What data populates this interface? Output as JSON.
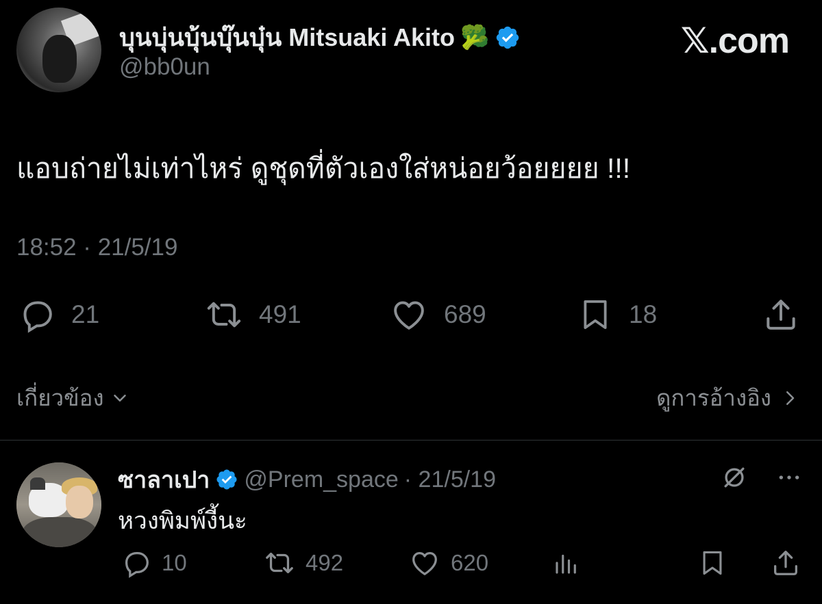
{
  "brand": {
    "text": "𝕏.com"
  },
  "main_tweet": {
    "author_name": "บุนบุ่นบุ้นบุ๊นบุ๋น Mitsuaki Akito",
    "name_emoji": "🥦",
    "handle": "@bb0un",
    "verified": true,
    "text": "แอบถ่ายไม่เท่าไหร่ ดูชุดที่ตัวเองใส่หน่อยว้อยยยย !!!",
    "timestamp": "18:52 · 21/5/19",
    "stats": {
      "replies": "21",
      "retweets": "491",
      "likes": "689",
      "bookmarks": "18"
    }
  },
  "related": {
    "label": "เกี่ยวข้อง"
  },
  "quotes": {
    "label": "ดูการอ้างอิง"
  },
  "reply": {
    "author_name": "ซาลาเปา",
    "verified": true,
    "handle": "@Prem_space",
    "date": "· 21/5/19",
    "text": "หวงพิมพ์งี้นะ",
    "stats": {
      "replies": "10",
      "retweets": "492",
      "likes": "620"
    }
  },
  "colors": {
    "background": "#000000",
    "text_primary": "#e7e9ea",
    "text_secondary": "#71767b",
    "verified_blue": "#1d9bf0",
    "divider": "#2f3336"
  },
  "icons": [
    "reply-icon",
    "retweet-icon",
    "like-icon",
    "bookmark-icon",
    "share-icon",
    "chevron-down-icon",
    "chevron-right-icon",
    "grok-icon",
    "more-icon",
    "views-icon",
    "verified-badge-icon"
  ]
}
